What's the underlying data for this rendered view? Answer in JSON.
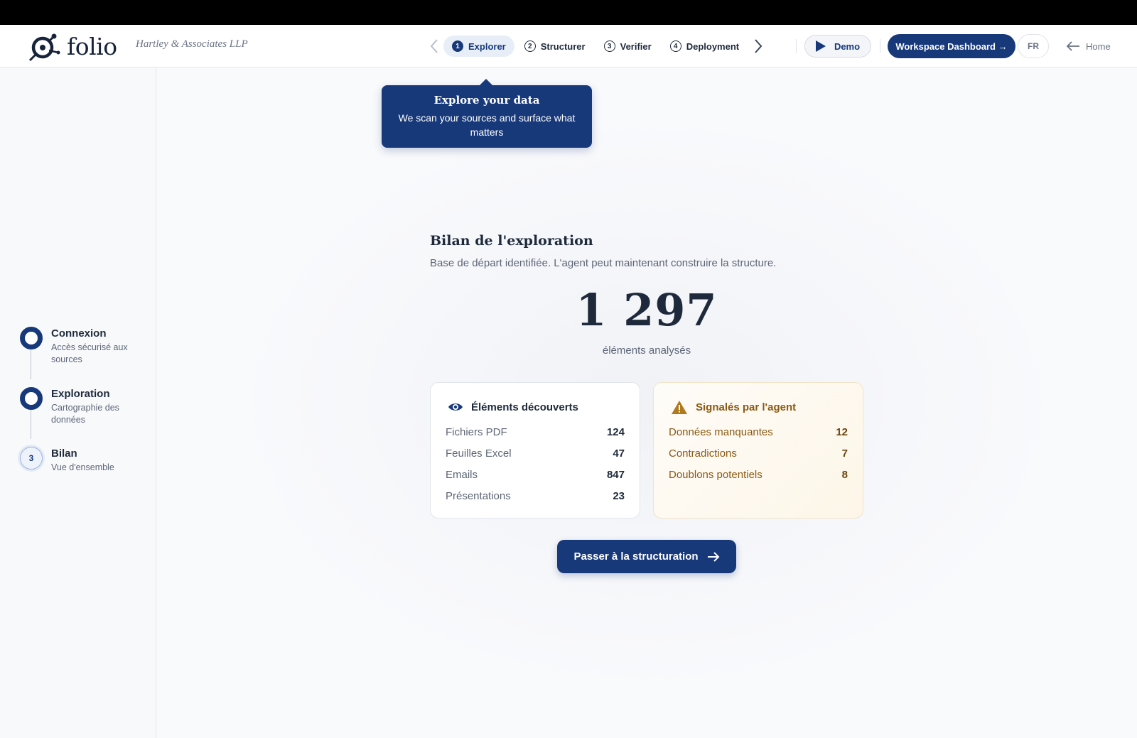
{
  "app": {
    "logo_text": "folio",
    "company": "Hartley & Associates LLP"
  },
  "nav": {
    "steps": [
      {
        "num": "1",
        "label": "Explorer",
        "active": true
      },
      {
        "num": "2",
        "label": "Structurer",
        "active": false
      },
      {
        "num": "3",
        "label": "Verifier",
        "active": false
      },
      {
        "num": "4",
        "label": "Deployment",
        "active": false
      }
    ],
    "demo_label": "Demo",
    "dashboard_label": "Workspace Dashboard →",
    "lang_label": "FR",
    "home_label": "Home"
  },
  "tooltip": {
    "title": "Explore your data",
    "body": "We scan your sources and surface what matters"
  },
  "sidebar": {
    "steps": [
      {
        "num": "",
        "title": "Connexion",
        "subtitle": "Accès sécurisé aux sources",
        "state": "done"
      },
      {
        "num": "",
        "title": "Exploration",
        "subtitle": "Cartographie des données",
        "state": "done"
      },
      {
        "num": "3",
        "title": "Bilan",
        "subtitle": "Vue d'ensemble",
        "state": "pending"
      }
    ]
  },
  "summary": {
    "title": "Bilan de l'exploration",
    "subtitle": "Base de départ identifiée. L'agent peut maintenant construire la structure.",
    "total": "1 297",
    "total_label": "éléments analysés"
  },
  "discovered": {
    "title": "Éléments découverts",
    "rows": [
      {
        "label": "Fichiers PDF",
        "value": "124"
      },
      {
        "label": "Feuilles Excel",
        "value": "47"
      },
      {
        "label": "Emails",
        "value": "847"
      },
      {
        "label": "Présentations",
        "value": "23"
      }
    ]
  },
  "flagged": {
    "title": "Signalés par l'agent",
    "rows": [
      {
        "label": "Données manquantes",
        "value": "12"
      },
      {
        "label": "Contradictions",
        "value": "7"
      },
      {
        "label": "Doublons potentiels",
        "value": "8"
      }
    ]
  },
  "cta": {
    "label": "Passer à la structuration"
  },
  "colors": {
    "primary": "#17397a",
    "warning": "#8a5a13"
  }
}
